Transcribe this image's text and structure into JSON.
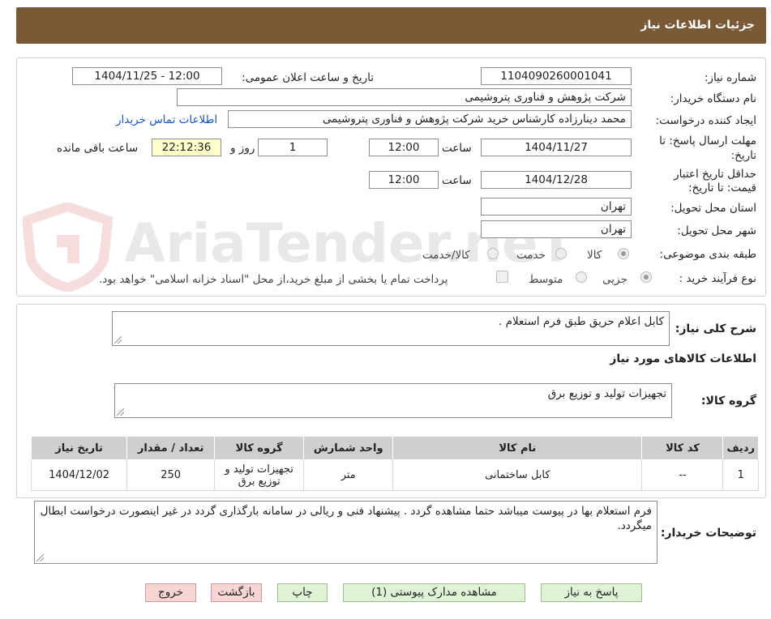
{
  "header": {
    "title": "جزئیات اطلاعات نیاز"
  },
  "watermark": {
    "text": "AriaTender.neT"
  },
  "form": {
    "need_number": {
      "label": "شماره نیاز:",
      "value": "1104090260001041"
    },
    "announce_datetime": {
      "label": "تاریخ و ساعت اعلان عمومی:",
      "value": "1404/11/25 - 12:00"
    },
    "buyer_org": {
      "label": "نام دستگاه خریدار:",
      "value": "شرکت پژوهش و فناوری پتروشیمی"
    },
    "requester": {
      "label": "ایجاد کننده درخواست:",
      "value": "محمد دینارزاده کارشناس خرید شرکت پژوهش و فناوری پتروشیمی"
    },
    "buyer_contact_link": "اطلاعات تماس خریدار",
    "response_deadline": {
      "label_line1": "مهلت ارسال پاسخ: تا",
      "label_line2": "تاریخ:",
      "date": "1404/11/27",
      "time_label": "ساعت",
      "time": "12:00",
      "days": "1",
      "days_label": "روز و",
      "remaining_time": "22:12:36",
      "remaining_label": "ساعت باقی مانده"
    },
    "price_validity": {
      "label_line1": "حداقل تاریخ اعتبار",
      "label_line2": "قیمت: تا تاریخ:",
      "date": "1404/12/28",
      "time_label": "ساعت",
      "time": "12:00"
    },
    "delivery_province": {
      "label": "استان محل تحویل:",
      "value": "تهران"
    },
    "delivery_city": {
      "label": "شهر محل تحویل:",
      "value": "تهران"
    },
    "category": {
      "label": "طبقه بندی موضوعی:",
      "options": [
        "کالا",
        "خدمت",
        "کالا/خدمت"
      ],
      "selected": "کالا"
    },
    "purchase_process": {
      "label": "نوع فرآیند خرید :",
      "options": [
        "جزیی",
        "متوسط"
      ],
      "selected": "جزیی",
      "treasury_note": "پرداخت تمام یا بخشی از مبلغ خرید،از محل \"اسناد خزانه اسلامی\" خواهد بود."
    }
  },
  "description": {
    "label": "شرح کلی نیاز:",
    "value": "کابل اعلام حریق طبق فرم استعلام ."
  },
  "goods_info": {
    "title": "اطلاعات کالاهای مورد نیاز",
    "group_label": "گروه کالا:",
    "group_value": "تجهیزات تولید و توزیع برق",
    "columns": [
      "ردیف",
      "کد کالا",
      "نام کالا",
      "واحد شمارش",
      "گروه کالا",
      "تعداد / مقدار",
      "تاریخ نیاز"
    ],
    "rows": [
      [
        "1",
        "--",
        "کابل ساختمانی",
        "متر",
        "تجهیزات تولید و توزیع برق",
        "250",
        "1404/12/02"
      ]
    ]
  },
  "buyer_notes": {
    "label": "توضیحات خریدار:",
    "value": "فرم استعلام بها در پیوست میباشد حتما مشاهده گردد . پیشنهاد فنی و ریالی در سامانه بارگذاری گردد در غیر اینصورت درخواست ابطال میگردد."
  },
  "buttons": {
    "reply": "پاسخ به نیاز",
    "attachments": "مشاهده مدارک پیوستی (1)",
    "print": "چاپ",
    "back": "بازگشت",
    "exit": "خروج"
  },
  "colors": {
    "header_bg": "#7a5a36",
    "link": "#1a55b8",
    "green_btn": "#dff2d6",
    "pink_btn": "#f8d5d5"
  }
}
